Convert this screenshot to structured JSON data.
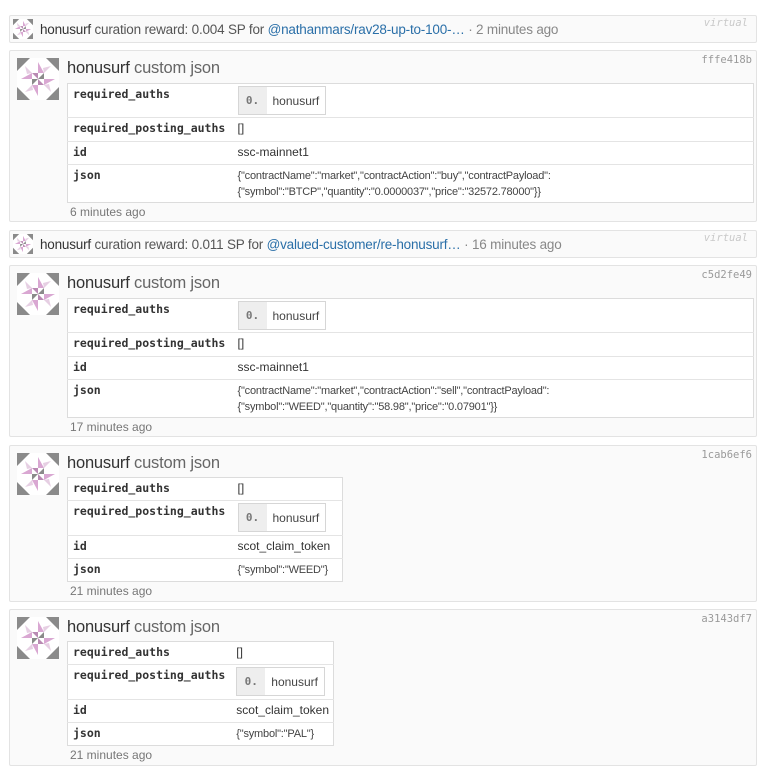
{
  "events": [
    {
      "kind": "virtual",
      "user": "honusurf",
      "text": "curation reward: 0.004 SP for",
      "link": "@nathanmars/rav28-up-to-100-…",
      "time": "· 2 minutes ago",
      "tag": "virtual"
    },
    {
      "kind": "op",
      "hash": "fffe418b",
      "user": "honusurf",
      "op_type": "custom json",
      "params": {
        "required_auths_key": "required_auths",
        "required_auths_index": "0.",
        "required_auths_name": "honusurf",
        "required_posting_auths_key": "required_posting_auths",
        "required_posting_auths_value": "[]",
        "id_key": "id",
        "id_value": "ssc-mainnet1",
        "json_key": "json",
        "json_line1": "{\"contractName\":\"market\",\"contractAction\":\"buy\",\"contractPayload\":",
        "json_line2": "{\"symbol\":\"BTCP\",\"quantity\":\"0.0000037\",\"price\":\"32572.78000\"}}"
      },
      "time": "6 minutes ago"
    },
    {
      "kind": "virtual",
      "user": "honusurf",
      "text": "curation reward: 0.011 SP for",
      "link": "@valued-customer/re-honusurf…",
      "time": "· 16 minutes ago",
      "tag": "virtual"
    },
    {
      "kind": "op",
      "hash": "c5d2fe49",
      "user": "honusurf",
      "op_type": "custom json",
      "params": {
        "required_auths_key": "required_auths",
        "required_auths_index": "0.",
        "required_auths_name": "honusurf",
        "required_posting_auths_key": "required_posting_auths",
        "required_posting_auths_value": "[]",
        "id_key": "id",
        "id_value": "ssc-mainnet1",
        "json_key": "json",
        "json_line1": "{\"contractName\":\"market\",\"contractAction\":\"sell\",\"contractPayload\":",
        "json_line2": "{\"symbol\":\"WEED\",\"quantity\":\"58.98\",\"price\":\"0.07901\"}}"
      },
      "time": "17 minutes ago"
    },
    {
      "kind": "op",
      "hash": "1cab6ef6",
      "user": "honusurf",
      "op_type": "custom json",
      "params": {
        "required_auths_key": "required_auths",
        "required_auths_value": "[]",
        "required_posting_auths_key": "required_posting_auths",
        "required_posting_auths_index": "0.",
        "required_posting_auths_name": "honusurf",
        "id_key": "id",
        "id_value": "scot_claim_token",
        "json_key": "json",
        "json_value": "{\"symbol\":\"WEED\"}"
      },
      "time": "21 minutes ago"
    },
    {
      "kind": "op",
      "hash": "a3143df7",
      "user": "honusurf",
      "op_type": "custom json",
      "params": {
        "required_auths_key": "required_auths",
        "required_auths_value": "[]",
        "required_posting_auths_key": "required_posting_auths",
        "required_posting_auths_index": "0.",
        "required_posting_auths_name": "honusurf",
        "id_key": "id",
        "id_value": "scot_claim_token",
        "json_key": "json",
        "json_value": "{\"symbol\":\"PAL\"}"
      },
      "time": "21 minutes ago"
    }
  ],
  "colors": {
    "link": "#2a6fa8",
    "avatar_pink": "#d9a7d2",
    "avatar_gray": "#8a8a8a"
  },
  "icons": {
    "avatar": "identicon-pinwheel"
  }
}
